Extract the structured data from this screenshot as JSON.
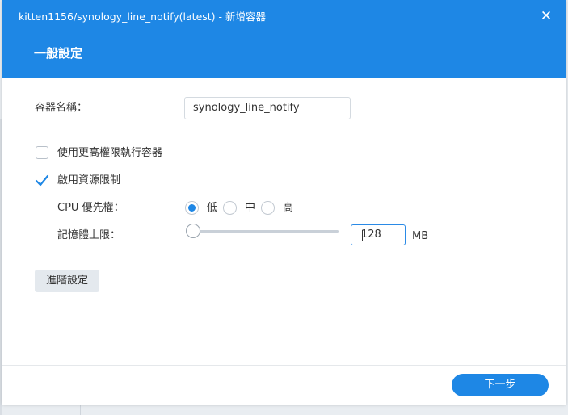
{
  "dialog": {
    "title": "kitten1156/synology_line_notify(latest) - 新增容器",
    "close_symbol": "✕",
    "section_title": "一般設定"
  },
  "form": {
    "container_name_label": "容器名稱：",
    "container_name_value": "synology_line_notify",
    "privileged_label": "使用更高權限執行容器",
    "privileged_checked": false,
    "resource_limit_label": "啟用資源限制",
    "resource_limit_checked": true,
    "cpu_priority_label": "CPU 優先權：",
    "cpu_options": [
      "低",
      "中",
      "高"
    ],
    "cpu_selected": "低",
    "memory_label": "記憶體上限：",
    "memory_value": "128",
    "memory_unit": "MB",
    "memory_slider_fraction": 0
  },
  "buttons": {
    "advanced_label": "進階設定",
    "next_label": "下一步"
  },
  "colors": {
    "accent": "#1e87e5",
    "header_text": "#ffffff"
  },
  "icons": {
    "close": "close-icon",
    "check": "checkmark-icon"
  }
}
